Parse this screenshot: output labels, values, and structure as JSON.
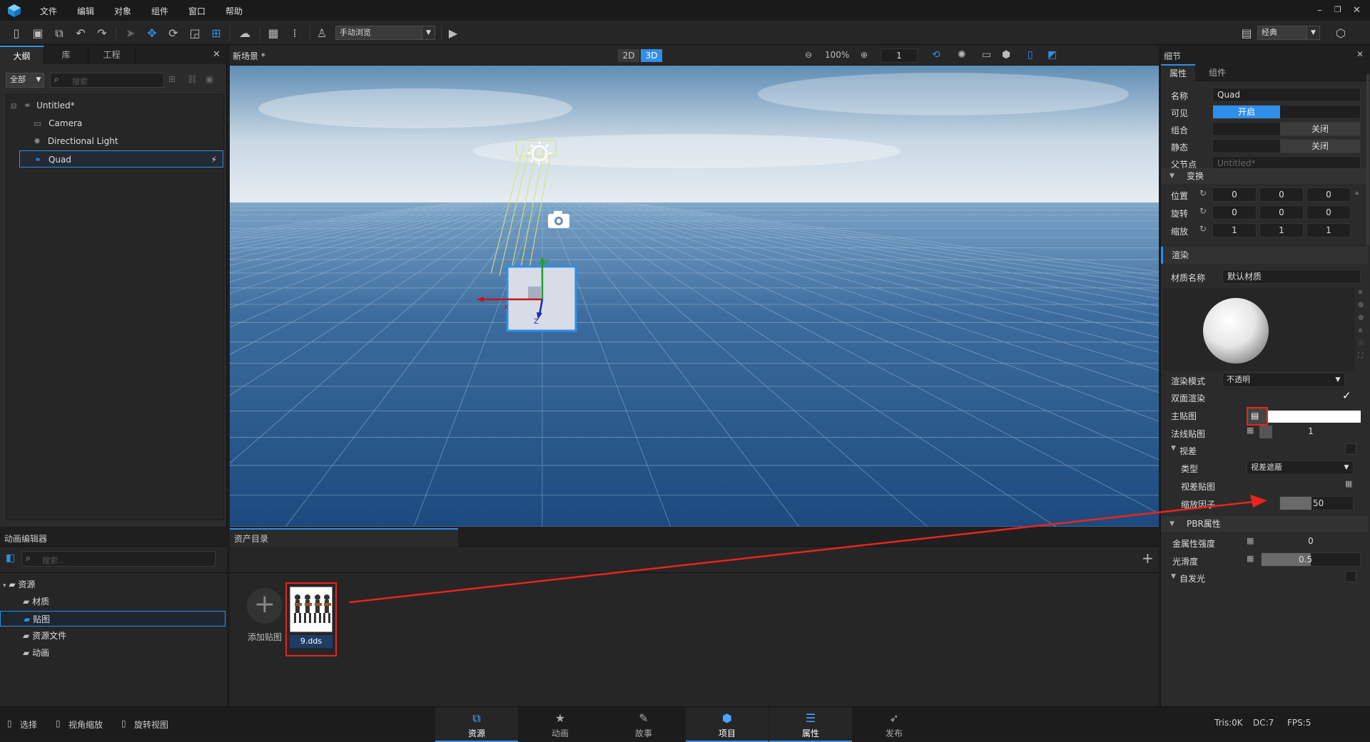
{
  "menubar": {
    "items": [
      "文件",
      "编辑",
      "对象",
      "组件",
      "窗口",
      "帮助"
    ]
  },
  "toolbar": {
    "camera_mode": "手动浏览",
    "layout_preset": "经典"
  },
  "outliner": {
    "tabs": [
      "大纲",
      "库",
      "工程"
    ],
    "filter": "全部",
    "search_placeholder": "搜索",
    "tree": {
      "root": "Untitled*",
      "children": [
        "Camera",
        "Directional Light",
        "Quad"
      ]
    }
  },
  "viewport": {
    "title": "新场景 *",
    "mode_2d": "2D",
    "mode_3d": "3D",
    "zoom": "100%",
    "layer_value": "1"
  },
  "anim_panel": {
    "title": "动画编辑器",
    "search_placeholder": "搜索...",
    "tree_root": "资源",
    "folders": [
      "材质",
      "贴图",
      "资源文件",
      "动画"
    ]
  },
  "asset_panel": {
    "title": "资产目录",
    "add_label": "添加贴图",
    "asset_name": "9.dds"
  },
  "details": {
    "title": "细节",
    "tabs": [
      "属性",
      "组件"
    ],
    "name_label": "名称",
    "name_value": "Quad",
    "visible_label": "可见",
    "visible_value": "开启",
    "group_label": "组合",
    "group_value": "关闭",
    "static_label": "静态",
    "static_value": "关闭",
    "parent_label": "父节点",
    "parent_value": "Untitled*",
    "transform_section": "变换",
    "position_label": "位置",
    "position": [
      "0",
      "0",
      "0"
    ],
    "rotation_label": "旋转",
    "rotation": [
      "0",
      "0",
      "0"
    ],
    "scale_label": "缩放",
    "scale": [
      "1",
      "1",
      "1"
    ],
    "render_section": "渲染",
    "material_label": "材质名称",
    "material_value": "默认材质",
    "render_mode_label": "渲染模式",
    "render_mode_value": "不透明",
    "double_side_label": "双面渲染",
    "main_tex_label": "主贴图",
    "normal_tex_label": "法线贴图",
    "normal_value": "1",
    "parallax_label": "视差",
    "type_label": "类型",
    "type_value": "视差遮蔽",
    "parallax_tex_label": "视差贴图",
    "scale_factor_label": "缩放因子",
    "scale_factor_value": "50",
    "pbr_section": "PBR属性",
    "metal_label": "金属性强度",
    "metal_value": "0",
    "smooth_label": "光滑度",
    "smooth_value": "0.5",
    "emission_label": "自发光"
  },
  "statusbar": {
    "tools": [
      "选择",
      "视角缩放",
      "旋转视图"
    ],
    "nav": [
      "资源",
      "动画",
      "故事",
      "项目",
      "属性",
      "发布"
    ],
    "tris": "Tris:0K",
    "dc": "DC:7",
    "fps": "FPS:5"
  },
  "colors": {
    "accent": "#2f8fe8",
    "highlight": "#e8251d"
  }
}
